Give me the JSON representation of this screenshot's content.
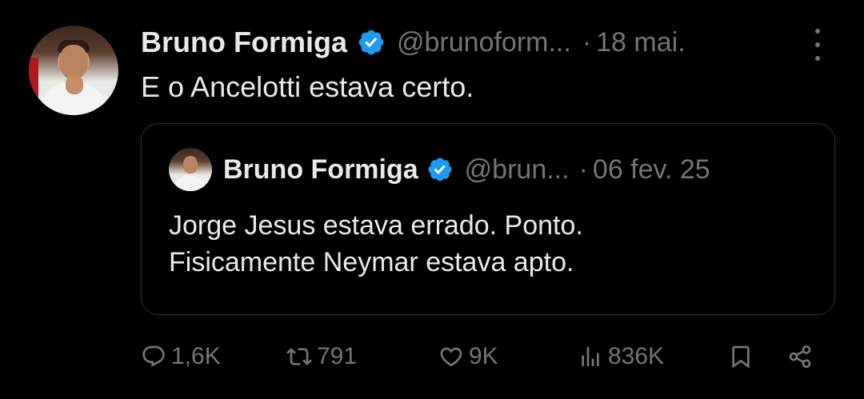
{
  "tweet": {
    "author_name": "Bruno Formiga",
    "handle": "@brunoform...",
    "separator": "·",
    "date": "18 mai.",
    "text": "E o Ancelotti estava certo."
  },
  "quoted_tweet": {
    "author_name": "Bruno Formiga",
    "handle": "@brun...",
    "separator": "·",
    "date": "06 fev. 25",
    "lines": [
      "Jorge Jesus estava errado. Ponto.",
      "Fisicamente Neymar estava apto."
    ]
  },
  "actions": {
    "replies": "1,6K",
    "retweets": "791",
    "likes": "9K",
    "views": "836K"
  },
  "icons": {
    "verified": "verified-badge-icon",
    "more": "more-options-icon",
    "reply": "reply-icon",
    "retweet": "retweet-icon",
    "like": "heart-icon",
    "views": "views-chart-icon",
    "bookmark": "bookmark-icon",
    "share": "share-icon"
  },
  "colors": {
    "background": "#000000",
    "text": "#e7e9ea",
    "secondary": "#71767b",
    "verified": "#1d9bf0",
    "border": "#2f3336"
  }
}
